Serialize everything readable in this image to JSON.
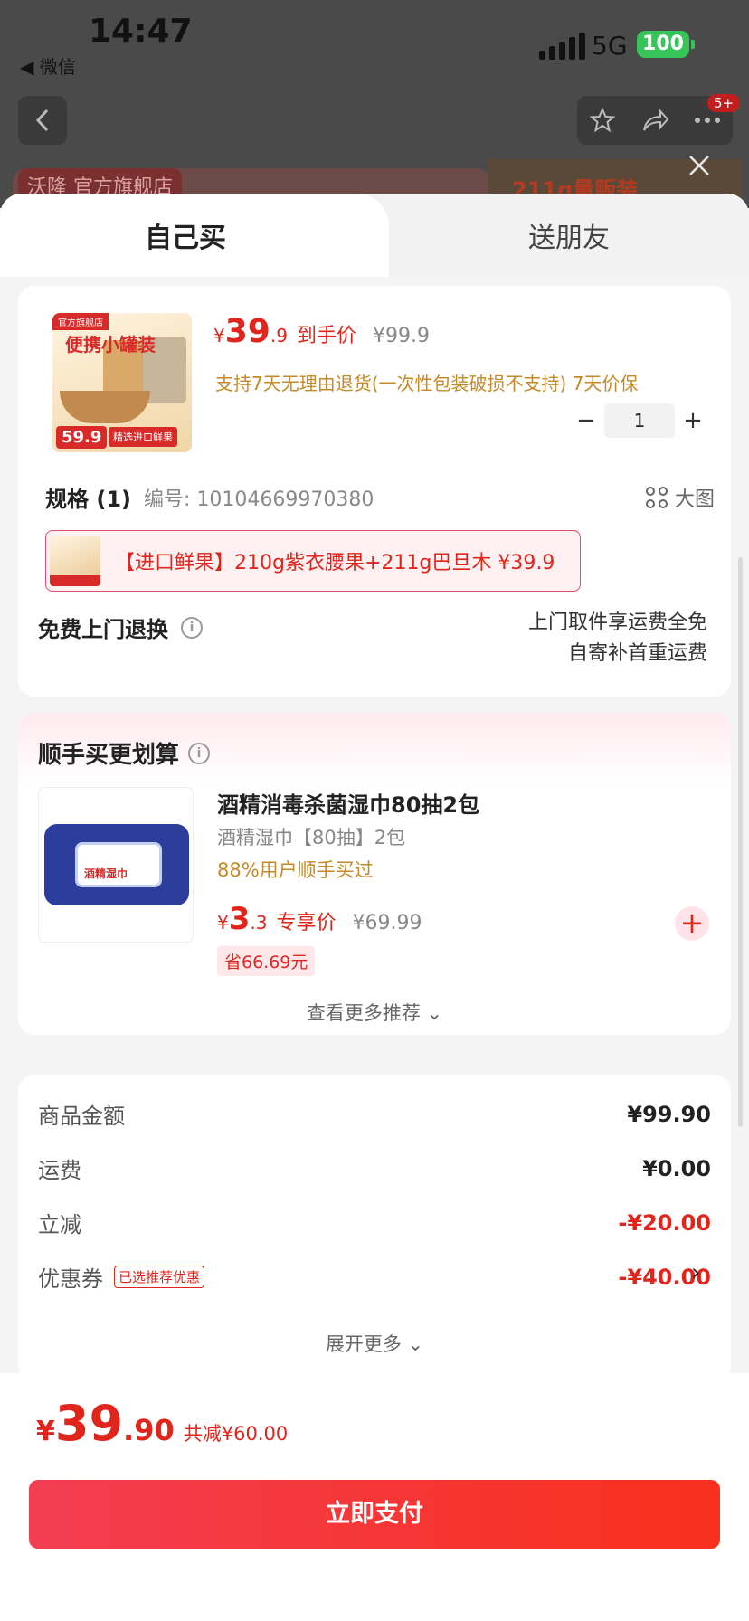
{
  "status": {
    "time": "14:47",
    "back_app": "◀ 微信",
    "network": "5G",
    "battery": "100"
  },
  "background": {
    "store": "沃隆 官方旗舰店",
    "promo": "211g量贩装",
    "badge": "5+"
  },
  "tabs": {
    "self": "自己买",
    "gift": "送朋友"
  },
  "product": {
    "thumb_tag": "官方旗舰店",
    "thumb_text": "便携小罐装",
    "thumb_price": "59.9",
    "thumb_badge": "精选进口鲜果",
    "currency": "¥",
    "price_int": "39",
    "price_dec": ".9",
    "price_label": "到手价",
    "original_price": "¥99.9",
    "policy": "支持7天无理由退货(一次性包装破损不支持)  7天价保",
    "quantity": "1",
    "minus": "−",
    "plus": "+"
  },
  "spec": {
    "title": "规格 (1)",
    "code": "编号: 10104669970380",
    "big_view": "大图",
    "selected_option": "【进口鲜果】210g紫衣腰果+211g巴旦木  ¥39.9"
  },
  "returns": {
    "title": "免费上门退换",
    "info": "i",
    "line1": "上门取件享运费全免",
    "line2": "自寄补首重运费"
  },
  "addon": {
    "title": "顺手买更划算",
    "info": "i",
    "image_label": "酒精湿巾",
    "name": "酒精消毒杀菌湿巾80抽2包",
    "spec": "酒精湿巾【80抽】2包",
    "bought": "88%用户顺手买过",
    "currency": "¥",
    "price_int": "3",
    "price_dec": ".3",
    "price_label": "专享价",
    "original_price": "¥69.99",
    "save": "省66.69元",
    "add": "+",
    "more": "查看更多推荐 ⌄"
  },
  "summary": {
    "goods_label": "商品金额",
    "goods_value": "¥99.90",
    "shipping_label": "运费",
    "shipping_value": "¥0.00",
    "discount_label": "立减",
    "discount_value": "-¥20.00",
    "coupon_label": "优惠券",
    "coupon_tag": "已选推荐优惠",
    "coupon_value": "-¥40.00",
    "coupon_arrow": "›",
    "expand": "展开更多 ⌄"
  },
  "footer": {
    "currency": "¥",
    "total_int": "39",
    "total_dec": ".90",
    "total_reduced": "共减¥60.00",
    "pay": "立即支付"
  },
  "colors": {
    "accent": "#e0261c",
    "pay_start": "#f33d52",
    "pay_end": "#f8301c",
    "gold": "#c58a28"
  }
}
